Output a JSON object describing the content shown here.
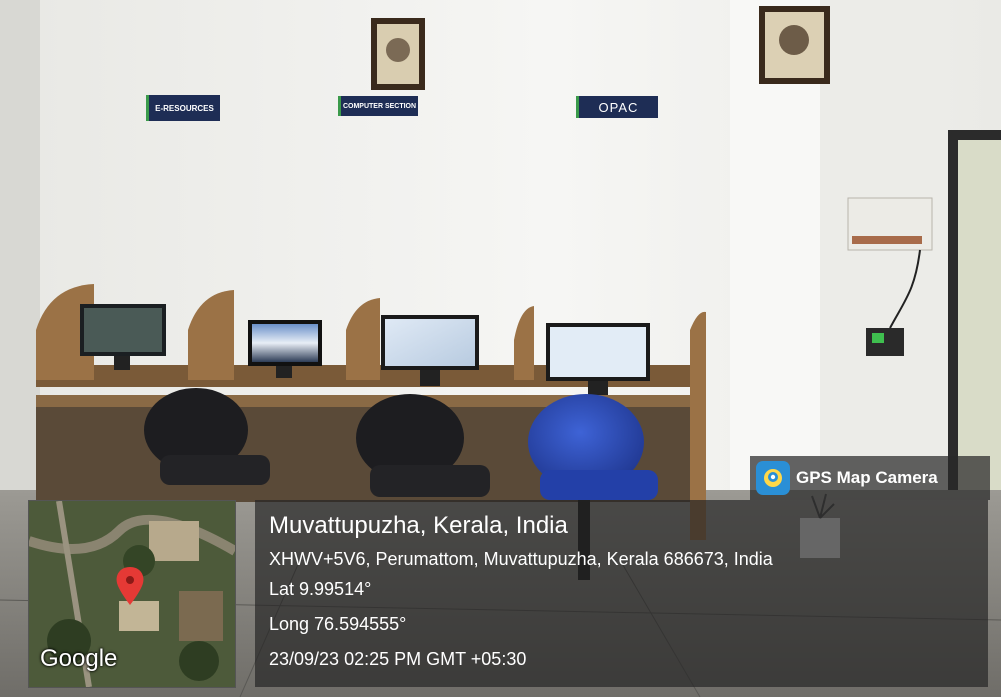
{
  "signs": {
    "e_resources": "E-RESOURCES",
    "computer_section": "COMPUTER SECTION",
    "opac": "OPAC"
  },
  "stamp": {
    "app_name": "GPS Map Camera",
    "place": "Muvattupuzha, Kerala, India",
    "address": "XHWV+5V6, Perumattom, Muvattupuzha, Kerala 686673, India",
    "lat": "Lat 9.99514°",
    "long": "Long 76.594555°",
    "datetime": "23/09/23 02:25 PM GMT +05:30"
  },
  "map": {
    "label": "Google",
    "pin_color": "#e53935"
  },
  "colors": {
    "wall": "#f2f2ef",
    "sign_bg": "#1e2d55",
    "desk_wood": "#8a6a45",
    "chair_blue": "#2b4bb5",
    "chair_black": "#1d1d20"
  }
}
